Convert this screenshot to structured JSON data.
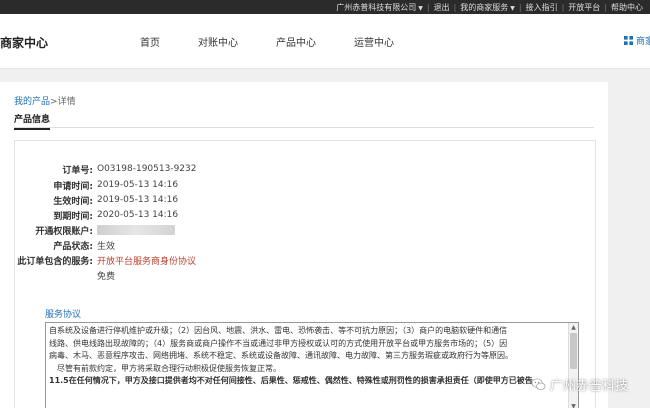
{
  "topbar": {
    "company": "广州赤普科技有限公司",
    "logout": "退出",
    "my_services": "我的商家服务",
    "guide": "接入指引",
    "open_platform": "开放平台",
    "help": "帮助中心"
  },
  "header": {
    "brand": "商家中心",
    "nav": [
      "首页",
      "对账中心",
      "产品中心",
      "运营中心"
    ],
    "merchant_link": "商家"
  },
  "breadcrumb": {
    "parent": "我的产品",
    "separator": ">",
    "current": "详情"
  },
  "section": {
    "title": "产品信息"
  },
  "detail": {
    "order_no_label": "订单号:",
    "order_no": "O03198-190513-9232",
    "apply_time_label": "申请时间:",
    "apply_time": "2019-05-13 14:16",
    "effective_time_label": "生效时间:",
    "effective_time": "2019-05-13 14:16",
    "expire_time_label": "到期时间:",
    "expire_time": "2020-05-13 14:16",
    "account_label": "开通权限账户:",
    "status_label": "产品状态:",
    "status": "生效",
    "services_label": "此订单包含的服务:",
    "service_link": "开放平台服务商身份协议",
    "price": "免费"
  },
  "agreement": {
    "title": "服务协议",
    "lines": [
      "自系统及设备进行停机维护或升级；（2）因台风、地震、洪水、雷电、恐怖袭击、等不可抗力原因；（3）商户的电脑软硬件和通信",
      "线路、供电线路出现故障的；（4）服务商或商户操作不当或通过非甲方授权或认可的方式使用开放平台或甲方服务市场的；（5）因",
      "病毒、木马、恶意程序攻击、网络拥堵、系统不稳定、系统或设备故障、通讯故障、电力故障、第三方服务瑕疵或政府行为等原因。",
      "　尽管有前款约定，甲方将采取合理行动积极促使服务恢复正常。",
      "11.5在任何情况下，甲方及接口提供者均不对任何间接性、后果性、惩戒性、偶然性、特殊性或刑罚性的损害承担责任（即使甲方已被告"
    ]
  },
  "watermark": {
    "text": "广州赤普科技"
  }
}
